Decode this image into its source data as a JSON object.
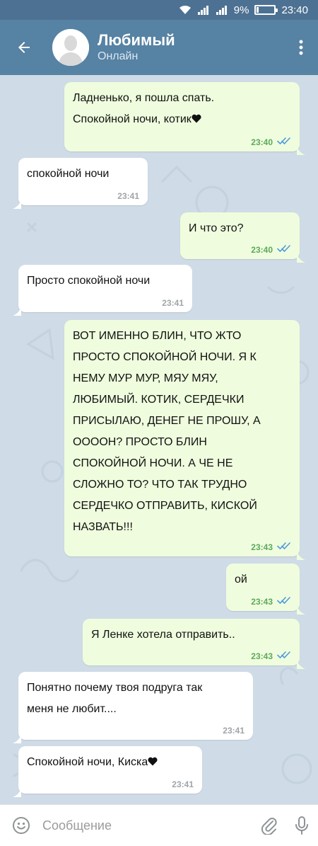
{
  "status_bar": {
    "battery_percent": "9%",
    "time": "23:40",
    "battery_level": 0.09
  },
  "header": {
    "title": "Любимый",
    "status": "Онлайн"
  },
  "messages": [
    {
      "dir": "out",
      "text": "Ладненько, я пошла спать.\nСпокойной ночи, котик",
      "heart": true,
      "time": "23:40",
      "read": true
    },
    {
      "dir": "in",
      "text": "спокойной ночи",
      "heart": false,
      "time": "23:41"
    },
    {
      "dir": "out",
      "text": "И что это?",
      "heart": false,
      "time": "23:40",
      "read": true
    },
    {
      "dir": "in",
      "text": "Просто спокойной ночи",
      "heart": false,
      "time": "23:41"
    },
    {
      "dir": "out",
      "text": "ВОТ ИМЕННО БЛИН, ЧТО ЖТО\nПРОСТО СПОКОЙНОЙ НОЧИ. Я К\nНЕМУ МУР МУР, МЯУ МЯУ,\nЛЮБИМЫЙ. КОТИК, СЕРДЕЧКИ\nПРИСЫЛАЮ, ДЕНЕГ НЕ ПРОШУ, А\nООООН? ПРОСТО БЛИН\nСПОКОЙНОЙ НОЧИ. А ЧЕ НЕ\nСЛОЖНО ТО? ЧТО ТАК ТРУДНО\nСЕРДЕЧКО ОТПРАВИТЬ, КИСКОЙ\nНАЗВАТЬ!!!",
      "heart": false,
      "time": "23:43",
      "read": true
    },
    {
      "dir": "out",
      "text": "ой",
      "heart": false,
      "time": "23:43",
      "read": true
    },
    {
      "dir": "out",
      "text": "Я Ленке хотела отправить..",
      "heart": false,
      "time": "23:43",
      "read": true
    },
    {
      "dir": "in",
      "text": "Понятно почему твоя подруга так\nменя не любит....",
      "heart": false,
      "time": "23:41"
    },
    {
      "dir": "in",
      "text": "Спокойной ночи, Киска",
      "heart": true,
      "time": "23:41"
    }
  ],
  "input": {
    "placeholder": "Сообщение"
  },
  "icons": {
    "back": "arrow-left-icon",
    "menu": "more-vertical-icon",
    "emoji": "smiley-icon",
    "attach": "paperclip-icon",
    "mic": "microphone-icon",
    "read_receipt": "double-check-icon",
    "wifi": "wifi-icon",
    "signal": "signal-icon",
    "battery": "battery-icon"
  },
  "colors": {
    "header": "#5682a3",
    "status_bar": "#4d7192",
    "chat_bg": "#cfdbe6",
    "bubble_out": "#effdde",
    "bubble_in": "#ffffff",
    "time_out": "#5da85d",
    "time_in": "#a0a5a9",
    "read_check": "#4f9ad9"
  }
}
